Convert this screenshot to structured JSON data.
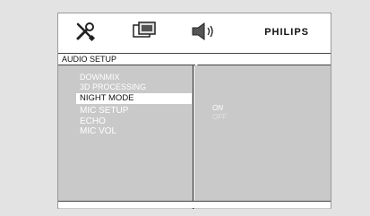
{
  "header": {
    "brand": "PHILIPS",
    "icons": [
      "tools-icon",
      "display-icon",
      "speaker-icon"
    ]
  },
  "title": "AUDIO SETUP",
  "menu": {
    "items": [
      {
        "label": "DOWNMIX"
      },
      {
        "label": "3D PROCESSING"
      },
      {
        "label": "NIGHT MODE"
      },
      {
        "label": "MIC SETUP"
      },
      {
        "label": "ECHO"
      },
      {
        "label": "MIC VOL"
      }
    ]
  },
  "options": {
    "on": "ON",
    "off": "OFF"
  },
  "colors": {
    "panel": "#c9c9c9",
    "background": "#e3e3e3",
    "highlight": "#ffffff"
  }
}
